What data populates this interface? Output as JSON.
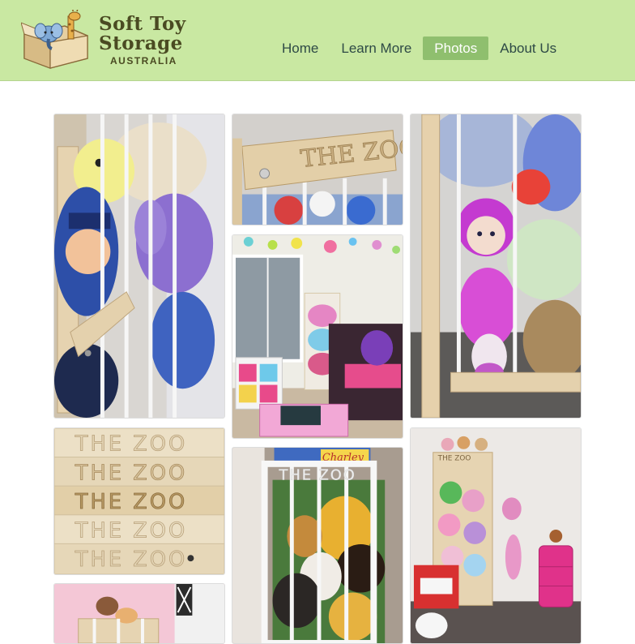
{
  "brand": {
    "line1": "Soft Toy",
    "line2": "Storage",
    "line3": "AUSTRALIA"
  },
  "nav": [
    {
      "label": "Home",
      "active": false
    },
    {
      "label": "Learn More",
      "active": false
    },
    {
      "label": "Photos",
      "active": true
    },
    {
      "label": "About Us",
      "active": false
    }
  ],
  "photos": {
    "zoo_sign_text": "THE ZOO",
    "charley_sign": "Charley"
  },
  "colors": {
    "header_bg": "#c9e8a2",
    "nav_active_bg": "#8fbf6e",
    "nav_text": "#2e4a46"
  }
}
